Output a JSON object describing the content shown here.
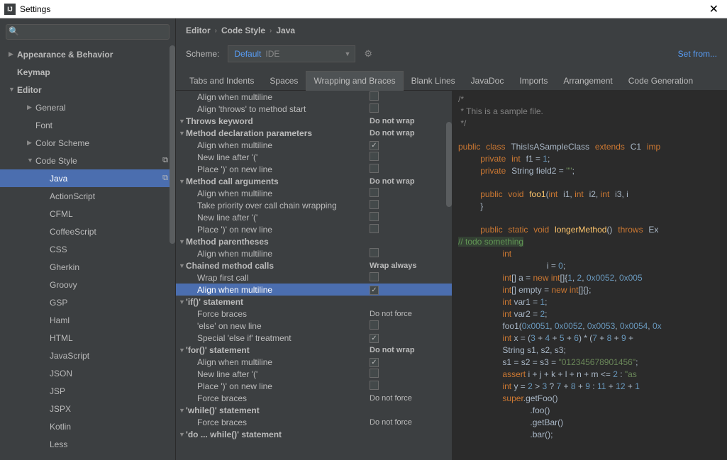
{
  "window": {
    "title": "Settings"
  },
  "search": {
    "placeholder": ""
  },
  "sidebar": [
    {
      "label": "Appearance & Behavior",
      "depth": 1,
      "arrow": "closed",
      "bold": true
    },
    {
      "label": "Keymap",
      "depth": 1,
      "bold": true
    },
    {
      "label": "Editor",
      "depth": 1,
      "arrow": "open",
      "bold": true
    },
    {
      "label": "General",
      "depth": 2,
      "arrow": "closed"
    },
    {
      "label": "Font",
      "depth": 2
    },
    {
      "label": "Color Scheme",
      "depth": 2,
      "arrow": "closed"
    },
    {
      "label": "Code Style",
      "depth": 2,
      "arrow": "open",
      "copy": true
    },
    {
      "label": "Java",
      "depth": 3,
      "selected": true,
      "copy": true
    },
    {
      "label": "ActionScript",
      "depth": 3
    },
    {
      "label": "CFML",
      "depth": 3
    },
    {
      "label": "CoffeeScript",
      "depth": 3
    },
    {
      "label": "CSS",
      "depth": 3
    },
    {
      "label": "Gherkin",
      "depth": 3
    },
    {
      "label": "Groovy",
      "depth": 3
    },
    {
      "label": "GSP",
      "depth": 3
    },
    {
      "label": "Haml",
      "depth": 3
    },
    {
      "label": "HTML",
      "depth": 3
    },
    {
      "label": "JavaScript",
      "depth": 3
    },
    {
      "label": "JSON",
      "depth": 3
    },
    {
      "label": "JSP",
      "depth": 3
    },
    {
      "label": "JSPX",
      "depth": 3
    },
    {
      "label": "Kotlin",
      "depth": 3
    },
    {
      "label": "Less",
      "depth": 3
    }
  ],
  "breadcrumb": [
    "Editor",
    "Code Style",
    "Java"
  ],
  "scheme": {
    "label": "Scheme:",
    "name": "Default",
    "scope": "IDE",
    "setfrom": "Set from..."
  },
  "tabs": [
    "Tabs and Indents",
    "Spaces",
    "Wrapping and Braces",
    "Blank Lines",
    "JavaDoc",
    "Imports",
    "Arrangement",
    "Code Generation"
  ],
  "activeTab": 2,
  "options": [
    {
      "t": "c",
      "label": "Align when multiline",
      "ctrl": "chk",
      "checked": false
    },
    {
      "t": "c",
      "label": "Align 'throws' to method start",
      "ctrl": "chk",
      "checked": false
    },
    {
      "t": "h",
      "label": "Throws keyword",
      "val": "Do not wrap"
    },
    {
      "t": "h",
      "label": "Method declaration parameters",
      "val": "Do not wrap"
    },
    {
      "t": "c",
      "label": "Align when multiline",
      "ctrl": "chk",
      "checked": true
    },
    {
      "t": "c",
      "label": "New line after '('",
      "ctrl": "chk",
      "checked": false
    },
    {
      "t": "c",
      "label": "Place ')' on new line",
      "ctrl": "chk",
      "checked": false
    },
    {
      "t": "h",
      "label": "Method call arguments",
      "val": "Do not wrap"
    },
    {
      "t": "c",
      "label": "Align when multiline",
      "ctrl": "chk",
      "checked": false
    },
    {
      "t": "c",
      "label": "Take priority over call chain wrapping",
      "ctrl": "chk",
      "checked": false
    },
    {
      "t": "c",
      "label": "New line after '('",
      "ctrl": "chk",
      "checked": false
    },
    {
      "t": "c",
      "label": "Place ')' on new line",
      "ctrl": "chk",
      "checked": false
    },
    {
      "t": "h",
      "label": "Method parentheses"
    },
    {
      "t": "c",
      "label": "Align when multiline",
      "ctrl": "chk",
      "checked": false
    },
    {
      "t": "h",
      "label": "Chained method calls",
      "val": "Wrap always"
    },
    {
      "t": "c",
      "label": "Wrap first call",
      "ctrl": "chk",
      "checked": false
    },
    {
      "t": "c",
      "label": "Align when multiline",
      "ctrl": "chk",
      "checked": true,
      "sel": true
    },
    {
      "t": "h",
      "label": "'if()' statement"
    },
    {
      "t": "c",
      "label": "Force braces",
      "val": "Do not force"
    },
    {
      "t": "c",
      "label": "'else' on new line",
      "ctrl": "chk",
      "checked": false
    },
    {
      "t": "c",
      "label": "Special 'else if' treatment",
      "ctrl": "chk",
      "checked": true
    },
    {
      "t": "h",
      "label": "'for()' statement",
      "val": "Do not wrap"
    },
    {
      "t": "c",
      "label": "Align when multiline",
      "ctrl": "chk",
      "checked": true
    },
    {
      "t": "c",
      "label": "New line after '('",
      "ctrl": "chk",
      "checked": false
    },
    {
      "t": "c",
      "label": "Place ')' on new line",
      "ctrl": "chk",
      "checked": false
    },
    {
      "t": "c",
      "label": "Force braces",
      "val": "Do not force"
    },
    {
      "t": "h",
      "label": "'while()' statement"
    },
    {
      "t": "c",
      "label": "Force braces",
      "val": "Do not force"
    },
    {
      "t": "h",
      "label": "'do ... while()' statement"
    }
  ],
  "code": {
    "l1": "/*",
    "l2": " * This is a sample file.",
    "l3": " */",
    "l4a": "public",
    "l4b": "class",
    "l4c": "ThisIsASampleClass",
    "l4d": "extends",
    "l4e": "C1",
    "l4f": "imp",
    "l5a": "private",
    "l5b": "int",
    "l5c": "f1 = ",
    "l5d": "1",
    "l5e": ";",
    "l6a": "private",
    "l6b": "String field2 = ",
    "l6c": "\"\"",
    "l6d": ";",
    "l8a": "public",
    "l8b": "void",
    "l8c": "foo1",
    "l8d": "(",
    "l8e": "int",
    "l8f": "i1, ",
    "l8g": "int",
    "l8h": "i2, ",
    "l8i": "int",
    "l8j": "i3, i",
    "l9": "}",
    "l11a": "public",
    "l11b": "static",
    "l11c": "void",
    "l11d": "longerMethod",
    "l11e": "()",
    "l11f": "throws",
    "l11g": "Ex",
    "l12": "// todo something",
    "l13a": "int",
    "l14a": "i = ",
    "l14b": "0",
    "l14c": ";",
    "l15a": "int",
    "l15b": "[] a = ",
    "l15c": "new",
    "l15d": " int",
    "l15e": "[]{",
    "l15f": "1",
    "l15g": ", ",
    "l15h": "2",
    "l15i": ", ",
    "l15j": "0x0052",
    "l15k": ", ",
    "l15l": "0x005",
    "l16a": "int",
    "l16b": "[] empty = ",
    "l16c": "new",
    "l16d": " int",
    "l16e": "[]{};",
    "l17a": "int",
    "l17b": " var1 = ",
    "l17c": "1",
    "l17d": ";",
    "l18a": "int",
    "l18b": " var2 = ",
    "l18c": "2",
    "l18d": ";",
    "l19a": "foo1(",
    "l19b": "0x0051",
    "l19c": ", ",
    "l19d": "0x0052",
    "l19e": ", ",
    "l19f": "0x0053",
    "l19g": ", ",
    "l19h": "0x0054",
    "l19i": ", ",
    "l19j": "0x",
    "l20a": "int",
    "l20b": " x = (",
    "l20c": "3",
    "l20d": " + ",
    "l20e": "4",
    "l20f": " + ",
    "l20g": "5",
    "l20h": " + ",
    "l20i": "6",
    "l20j": ") * (",
    "l20k": "7",
    "l20l": " + ",
    "l20m": "8",
    "l20n": " + ",
    "l20o": "9",
    "l20p": " +",
    "l21": "String s1, s2, s3;",
    "l22a": "s1 = s2 = s3 = ",
    "l22b": "\"012345678901456\"",
    "l22c": ";",
    "l23a": "assert",
    "l23b": " i + j + k + l + n + m <= ",
    "l23c": "2",
    "l23d": " : ",
    "l23e": "\"as",
    "l24a": "int",
    "l24b": " y = ",
    "l24c": "2",
    "l24d": " > ",
    "l24e": "3",
    "l24f": " ? ",
    "l24g": "7",
    "l24h": " + ",
    "l24i": "8",
    "l24j": " + ",
    "l24k": "9",
    "l24l": " : ",
    "l24m": "11",
    "l24n": " + ",
    "l24o": "12",
    "l24p": " + ",
    "l24q": "1",
    "l25a": "super",
    "l25b": ".getFoo()",
    "l26": ".foo()",
    "l27": ".getBar()",
    "l28": ".bar();"
  }
}
